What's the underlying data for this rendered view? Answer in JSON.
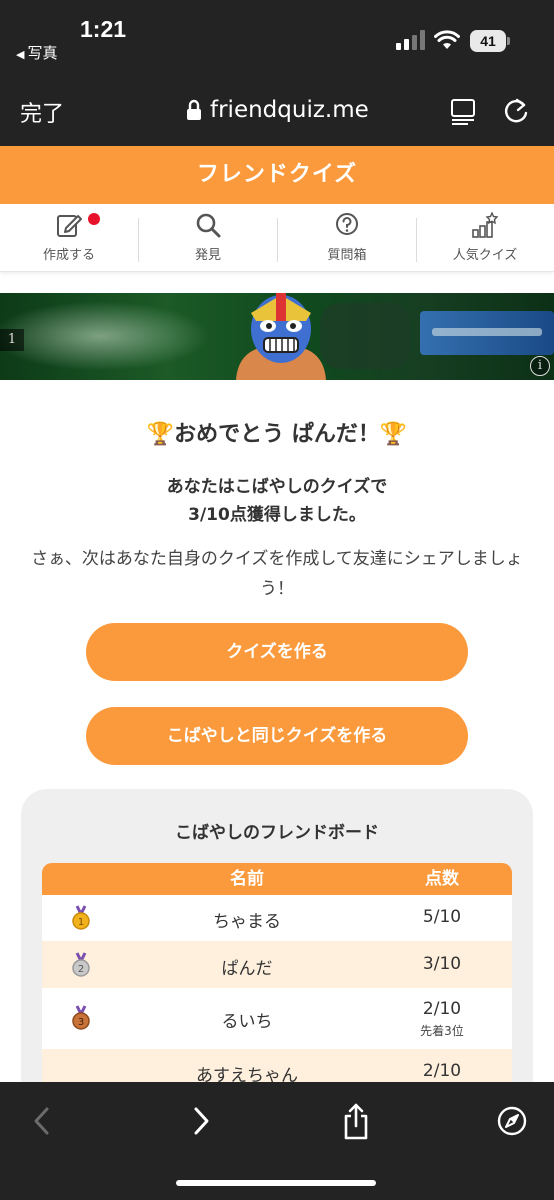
{
  "status_bar": {
    "time": "1:21",
    "back_app": "写真",
    "battery_level": "41"
  },
  "browser": {
    "done_label": "完了",
    "url": "friendquiz.me"
  },
  "site": {
    "title": "フレンドクイズ"
  },
  "nav": {
    "items": [
      {
        "label": "作成する",
        "icon": "edit-icon",
        "notification": true
      },
      {
        "label": "発見",
        "icon": "search-icon"
      },
      {
        "label": "質問箱",
        "icon": "question-icon"
      },
      {
        "label": "人気クイズ",
        "icon": "ranking-icon"
      }
    ]
  },
  "ad": {
    "badge": "1",
    "info": "i"
  },
  "result": {
    "congrats": "おめでとう ぱんだ！",
    "line1": "あなたはこばやしのクイズで",
    "line2": "3/10点獲得しました。",
    "cta": "さぁ、次はあなた自身のクイズを作成して友達にシェアしましょう！"
  },
  "buttons": {
    "make_quiz": "クイズを作る",
    "make_same_quiz": "こばやしと同じクイズを作る"
  },
  "board": {
    "title": "こばやしのフレンドボード",
    "columns": {
      "name": "名前",
      "score": "点数"
    },
    "rows": [
      {
        "medal": "gold",
        "name": "ちゃまる",
        "score": "5/10",
        "note": ""
      },
      {
        "medal": "silver",
        "name": "ぱんだ",
        "score": "3/10",
        "note": ""
      },
      {
        "medal": "bronze",
        "name": "るいち",
        "score": "2/10",
        "note": "先着3位"
      },
      {
        "medal": "",
        "name": "あすえちゃん",
        "score": "2/10",
        "note": ""
      }
    ]
  },
  "colors": {
    "accent": "#fb9a3c",
    "highlight_row": "#fff0de",
    "chrome": "#232323",
    "notification": "#e8132a"
  }
}
